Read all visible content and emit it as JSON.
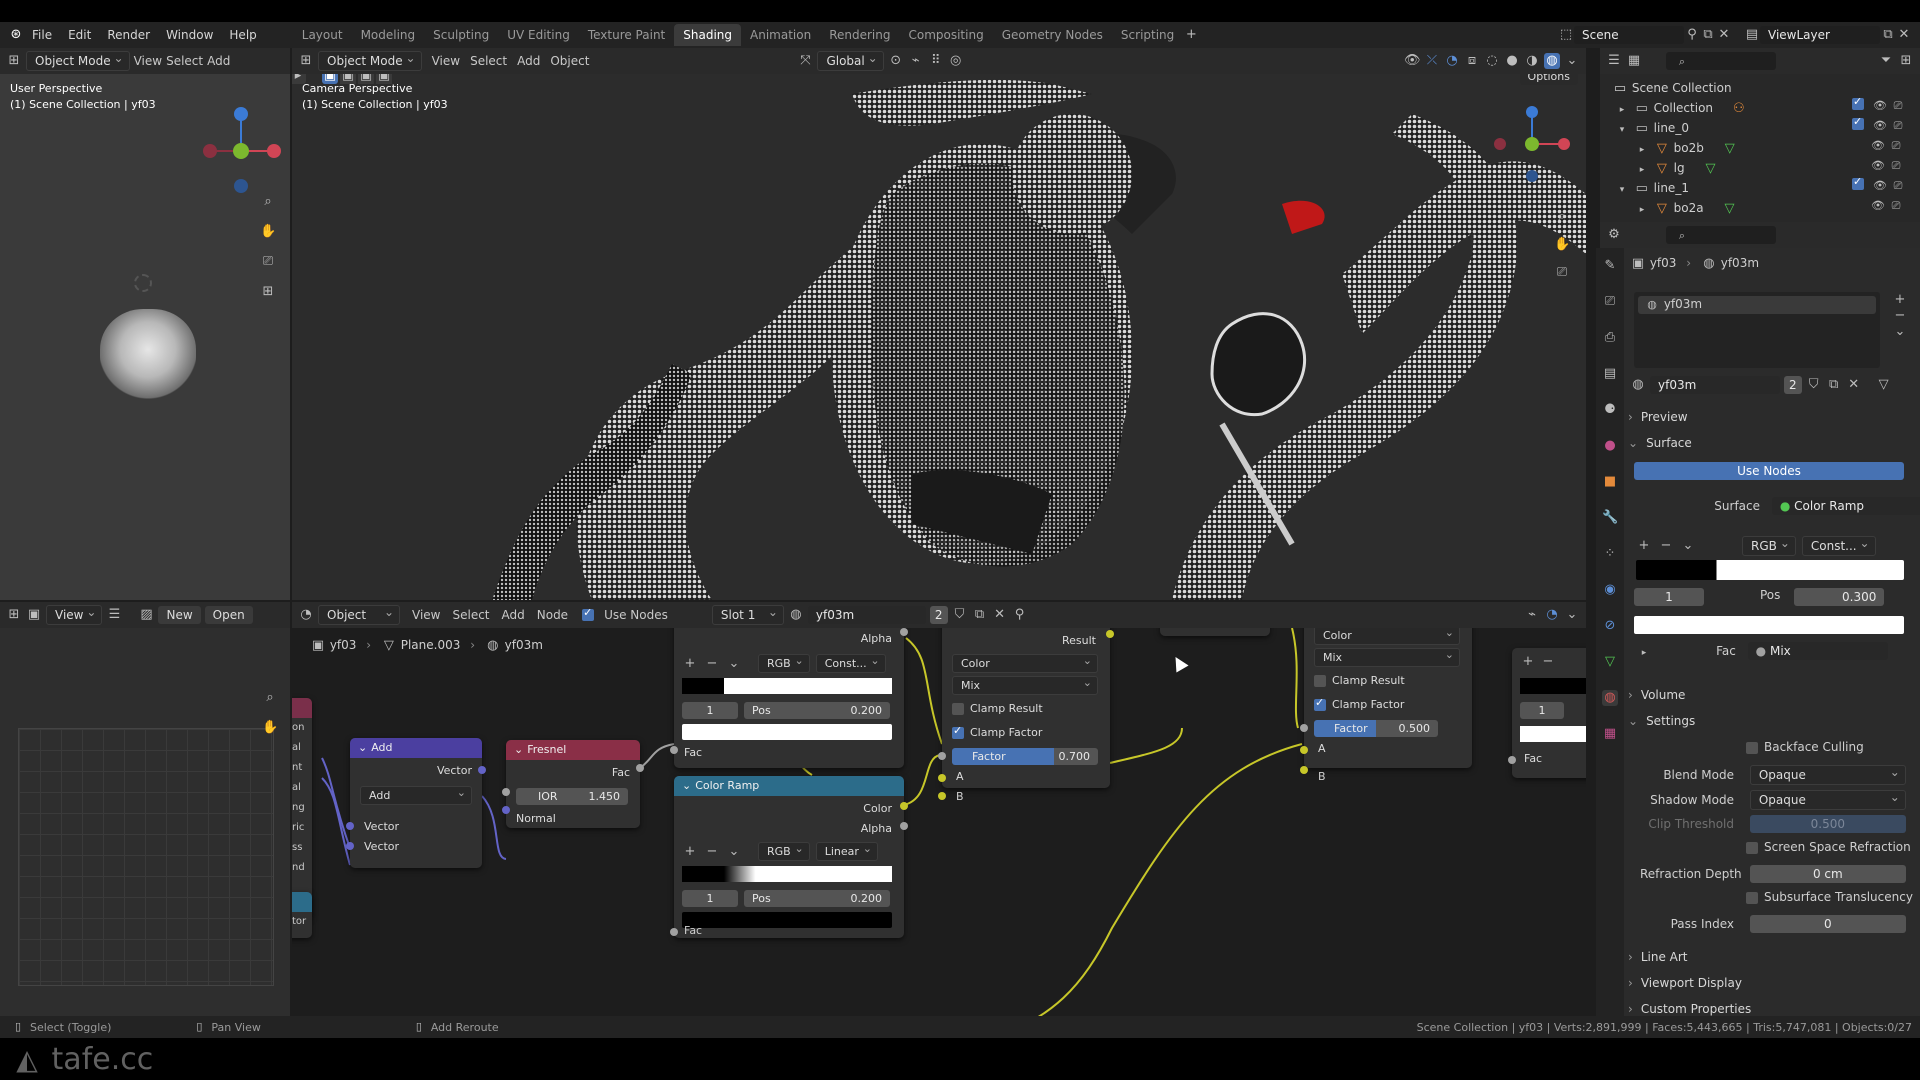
{
  "menus": [
    "File",
    "Edit",
    "Render",
    "Window",
    "Help"
  ],
  "workspaces": [
    "Layout",
    "Modeling",
    "Sculpting",
    "UV Editing",
    "Texture Paint",
    "Shading",
    "Animation",
    "Rendering",
    "Compositing",
    "Geometry Nodes",
    "Scripting"
  ],
  "active_workspace": "Shading",
  "scene": "Scene",
  "view_layer": "ViewLayer",
  "left_viewport": {
    "mode": "Object Mode",
    "menu": [
      "View",
      "Select",
      "Add"
    ],
    "overlay_line1": "User Perspective",
    "overlay_line2": "(1) Scene Collection | yf03"
  },
  "main_viewport": {
    "mode": "Object Mode",
    "menu": [
      "View",
      "Select",
      "Add",
      "Object"
    ],
    "orientation": "Global",
    "options": "Options",
    "overlay_line1": "Camera Perspective",
    "overlay_line2": "(1) Scene Collection | yf03"
  },
  "image_editor": {
    "view": "View",
    "new": "New",
    "open": "Open"
  },
  "node_editor": {
    "editor_type": "Object",
    "menu": [
      "View",
      "Select",
      "Add",
      "Node"
    ],
    "use_nodes": "Use Nodes",
    "slot": "Slot 1",
    "material": "yf03m",
    "users": "2",
    "breadcrumb": [
      "yf03",
      "Plane.003",
      "yf03m"
    ]
  },
  "nodes": {
    "add": {
      "title": "Add",
      "out": "Vector",
      "op": "Add",
      "in1": "Vector",
      "in2": "Vector"
    },
    "fresnel": {
      "title": "Fresnel",
      "out": "Fac",
      "ior_label": "IOR",
      "ior": "1.450",
      "in": "Normal"
    },
    "ramp_top": {
      "alpha": "Alpha",
      "mode": "RGB",
      "interp": "Const...",
      "idx": "1",
      "pos_label": "Pos",
      "pos": "0.200",
      "fac": "Fac"
    },
    "color_ramp": {
      "title": "Color Ramp",
      "out1": "Color",
      "out2": "Alpha",
      "mode": "RGB",
      "interp": "Linear",
      "idx": "1",
      "pos_label": "Pos",
      "pos": "0.200",
      "fac": "Fac"
    },
    "mix1": {
      "result": "Result",
      "type": "Color",
      "blend": "Mix",
      "clamp_result": "Clamp Result",
      "clamp_factor": "Clamp Factor",
      "factor_label": "Factor",
      "factor": "0.700",
      "a": "A",
      "b": "B"
    },
    "mix2": {
      "type": "Color",
      "blend": "Mix",
      "clamp_result": "Clamp Result",
      "clamp_factor": "Clamp Factor",
      "factor_label": "Factor",
      "factor": "0.500",
      "a": "A",
      "b": "B"
    },
    "ramp_right": {
      "idx": "1",
      "fac": "Fac"
    },
    "partial_left": [
      "on",
      "al",
      "nt",
      "al",
      "ng",
      "ric",
      "ss",
      "nd",
      "tor"
    ]
  },
  "outliner": {
    "root": "Scene Collection",
    "items": [
      {
        "name": "Collection",
        "indent": 0
      },
      {
        "name": "line_0",
        "indent": 0
      },
      {
        "name": "bo2b",
        "indent": 1
      },
      {
        "name": "lg",
        "indent": 1
      },
      {
        "name": "line_1",
        "indent": 0
      },
      {
        "name": "bo2a",
        "indent": 1
      }
    ]
  },
  "properties": {
    "breadcrumb": [
      "yf03",
      "yf03m"
    ],
    "slot_name": "yf03m",
    "material": "yf03m",
    "users": "2",
    "preview": "Preview",
    "surface_section": "Surface",
    "use_nodes": "Use Nodes",
    "surface_label": "Surface",
    "surface_value": "Color Ramp",
    "ramp_mode": "RGB",
    "ramp_interp": "Const...",
    "ramp_idx": "1",
    "pos_label": "Pos",
    "pos": "0.300",
    "fac_label": "Fac",
    "fac_value": "Mix",
    "volume": "Volume",
    "settings": "Settings",
    "backface_culling": "Backface Culling",
    "blend_mode_label": "Blend Mode",
    "blend_mode": "Opaque",
    "shadow_mode_label": "Shadow Mode",
    "shadow_mode": "Opaque",
    "clip_label": "Clip Threshold",
    "clip_value": "0.500",
    "ssr": "Screen Space Refraction",
    "refraction_depth_label": "Refraction Depth",
    "refraction_depth": "0 cm",
    "sss": "Subsurface Translucency",
    "pass_index_label": "Pass Index",
    "pass_index": "0",
    "line_art": "Line Art",
    "viewport_display": "Viewport Display",
    "custom_props": "Custom Properties"
  },
  "status": {
    "select": "Select (Toggle)",
    "pan": "Pan View",
    "reroute": "Add Reroute",
    "stats": "Scene Collection | yf03 | Verts:2,891,999 | Faces:5,443,665 | Tris:5,747,081 | Objects:0/27"
  },
  "watermark": "tafe.cc"
}
